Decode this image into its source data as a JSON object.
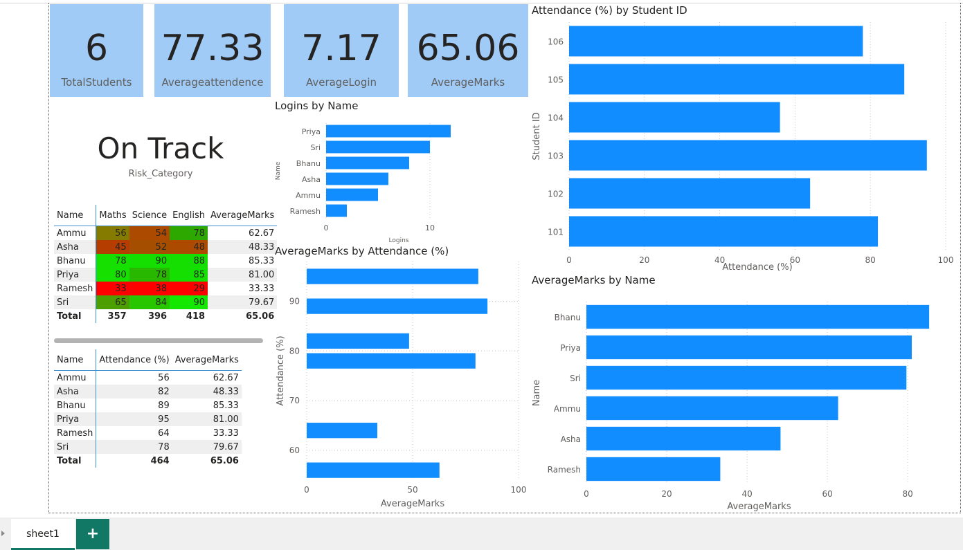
{
  "kpis": [
    {
      "value": "6",
      "label": "TotalStudents"
    },
    {
      "value": "77.33",
      "label": "Averageattendence"
    },
    {
      "value": "7.17",
      "label": "AverageLogin"
    },
    {
      "value": "65.06",
      "label": "AverageMarks"
    }
  ],
  "risk": {
    "value": "On Track",
    "label": "Risk_Category"
  },
  "marks_table": {
    "headers": [
      "Name",
      "Maths",
      "Science",
      "English",
      "AverageMarks"
    ],
    "rows": [
      {
        "name": "Ammu",
        "maths": "56",
        "science": "54",
        "english": "78",
        "avg": "62.67",
        "colors": [
          "#857b00",
          "#ac4a00",
          "#2da800"
        ]
      },
      {
        "name": "Asha",
        "maths": "45",
        "science": "52",
        "english": "48",
        "avg": "48.33",
        "colors": [
          "#b53d00",
          "#a64e00",
          "#ac4a00"
        ]
      },
      {
        "name": "Bhanu",
        "maths": "78",
        "science": "90",
        "english": "88",
        "avg": "85.33",
        "colors": [
          "#15e000",
          "#14df00",
          "#14df00"
        ]
      },
      {
        "name": "Priya",
        "maths": "80",
        "science": "78",
        "english": "85",
        "avg": "81.00",
        "colors": [
          "#15e000",
          "#28b800",
          "#14df00"
        ]
      },
      {
        "name": "Ramesh",
        "maths": "33",
        "science": "38",
        "english": "29",
        "avg": "33.33",
        "colors": [
          "#ff0000",
          "#ff0000",
          "#ff0000"
        ]
      },
      {
        "name": "Sri",
        "maths": "65",
        "science": "84",
        "english": "90",
        "avg": "79.67",
        "colors": [
          "#4d9e00",
          "#28c600",
          "#14e700"
        ]
      }
    ],
    "total": {
      "label": "Total",
      "maths": "357",
      "science": "396",
      "english": "418",
      "avg": "65.06"
    }
  },
  "attendance_table": {
    "headers": [
      "Name",
      "Attendance (%)",
      "AverageMarks"
    ],
    "rows": [
      {
        "name": "Ammu",
        "att": "56",
        "avg": "62.67"
      },
      {
        "name": "Asha",
        "att": "82",
        "avg": "48.33"
      },
      {
        "name": "Bhanu",
        "att": "89",
        "avg": "85.33"
      },
      {
        "name": "Priya",
        "att": "95",
        "avg": "81.00"
      },
      {
        "name": "Ramesh",
        "att": "64",
        "avg": "33.33"
      },
      {
        "name": "Sri",
        "att": "78",
        "avg": "79.67"
      }
    ],
    "total": {
      "label": "Total",
      "att": "464",
      "avg": "65.06"
    }
  },
  "tabs": {
    "sheet_label": "sheet1",
    "add_label": "+"
  },
  "chart_data": [
    {
      "type": "bar",
      "title": "Logins by Name",
      "xlabel": "Logins",
      "ylabel": "Name",
      "categories": [
        "Priya",
        "Sri",
        "Bhanu",
        "Asha",
        "Ammu",
        "Ramesh"
      ],
      "values": [
        12,
        10,
        8,
        6,
        5,
        2
      ],
      "xlim": [
        0,
        14
      ],
      "xticks": [
        0,
        10
      ],
      "color": "#118dff"
    },
    {
      "type": "bar",
      "title": "Attendance (%) by Student ID",
      "xlabel": "Attendance (%)",
      "ylabel": "Student ID",
      "categories": [
        "106",
        "105",
        "104",
        "103",
        "102",
        "101"
      ],
      "values": [
        78,
        89,
        56,
        95,
        64,
        82
      ],
      "xlim": [
        0,
        100
      ],
      "xticks": [
        0,
        20,
        40,
        60,
        80,
        100
      ],
      "color": "#118dff"
    },
    {
      "type": "bar",
      "title": "AverageMarks by Attendance (%)",
      "xlabel": "AverageMarks",
      "ylabel": "Attendance (%)",
      "points": [
        {
          "attendance": 95,
          "marks": 81.0
        },
        {
          "attendance": 89,
          "marks": 85.33
        },
        {
          "attendance": 82,
          "marks": 48.33
        },
        {
          "attendance": 78,
          "marks": 79.67
        },
        {
          "attendance": 64,
          "marks": 33.33
        },
        {
          "attendance": 56,
          "marks": 62.67
        }
      ],
      "xlim": [
        0,
        100
      ],
      "xticks": [
        0,
        50,
        100
      ],
      "ylim": [
        54,
        98
      ],
      "yticks": [
        60,
        70,
        80,
        90
      ],
      "color": "#118dff"
    },
    {
      "type": "bar",
      "title": "AverageMarks by Name",
      "xlabel": "AverageMarks",
      "ylabel": "Name",
      "categories": [
        "Bhanu",
        "Priya",
        "Sri",
        "Ammu",
        "Asha",
        "Ramesh"
      ],
      "values": [
        85.33,
        81.0,
        79.67,
        62.67,
        48.33,
        33.33
      ],
      "xlim": [
        0,
        86
      ],
      "xticks": [
        0,
        20,
        40,
        60,
        80
      ],
      "color": "#118dff"
    }
  ]
}
